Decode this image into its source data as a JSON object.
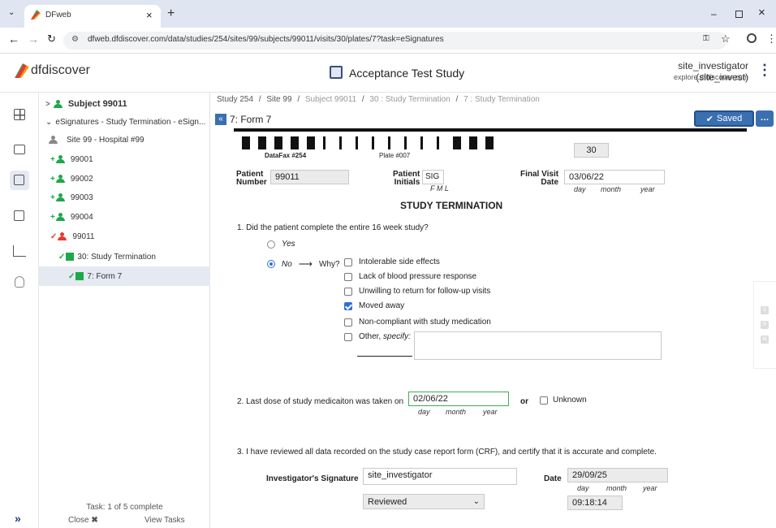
{
  "browser": {
    "tab_title": "DFweb",
    "url": "dfweb.dfdiscover.com/data/studies/254/sites/99/subjects/99011/visits/30/plates/7?task=eSignatures"
  },
  "app": {
    "logo_text": "dfdiscover",
    "study_title": "Acceptance Test Study",
    "user": "site_investigator (site_invest)",
    "server": "explore.dfdiscover.com"
  },
  "tree": {
    "subject": "Subject 99011",
    "task_group": "eSignatures - Study Termination - eSign...",
    "site": "Site 99 - Hospital #99",
    "subjects": [
      "99001",
      "99002",
      "99003",
      "99004",
      "99011"
    ],
    "visit": "30: Study Termination",
    "plate": "7: Form 7",
    "task_status": "Task: 1 of 5 complete",
    "close_label": "Close",
    "view_tasks_label": "View Tasks"
  },
  "breadcrumb": [
    "Study 254",
    "Site 99",
    "Subject 99011",
    "30 : Study Termination",
    "7 : Study Termination"
  ],
  "toolbar": {
    "form_title": "7: Form 7",
    "saved_label": "Saved",
    "more_label": "…"
  },
  "form": {
    "datafax": "DataFax #254",
    "plate": "Plate #007",
    "visit_num": "30",
    "patient_number_label_1": "Patient",
    "patient_number_label_2": "Number",
    "patient_number": "99011",
    "initials_label_1": "Patient",
    "initials_label_2": "Initials",
    "initials": "SIG",
    "initials_sub": "F   M   L",
    "final_visit_label_1": "Final Visit",
    "final_visit_label_2": "Date",
    "final_visit_date": "03/06/22",
    "date_sub_day": "day",
    "date_sub_month": "month",
    "date_sub_year": "year",
    "heading": "STUDY TERMINATION",
    "q1": "1.  Did the patient complete the entire 16 week study?",
    "q1_yes": "Yes",
    "q1_no": "No",
    "q1_why": "Why?",
    "reasons": [
      {
        "label": "Intolerable side effects",
        "checked": false
      },
      {
        "label": "Lack of blood pressure response",
        "checked": false
      },
      {
        "label": "Unwilling to return for follow-up visits",
        "checked": false
      },
      {
        "label": "Moved away",
        "checked": true
      },
      {
        "label": "Non-compliant with study medication",
        "checked": false
      }
    ],
    "other_label": "Other,",
    "other_specify": "specify:",
    "q2": "2.  Last dose of study medicaiton was taken on",
    "q2_date": "02/06/22",
    "q2_or": "or",
    "q2_unknown": "Unknown",
    "q3": "3.  I have reviewed all data recorded on the study case report form (CRF), and certify that it is accurate and complete.",
    "sig_label": "Investigator's Signature",
    "sig_value": "site_investigator",
    "sig_date_label": "Date",
    "sig_date": "29/09/25",
    "sig_status": "Reviewed",
    "sig_time": "09:18:14"
  },
  "side_panel": [
    "Q",
    "R",
    "M"
  ]
}
